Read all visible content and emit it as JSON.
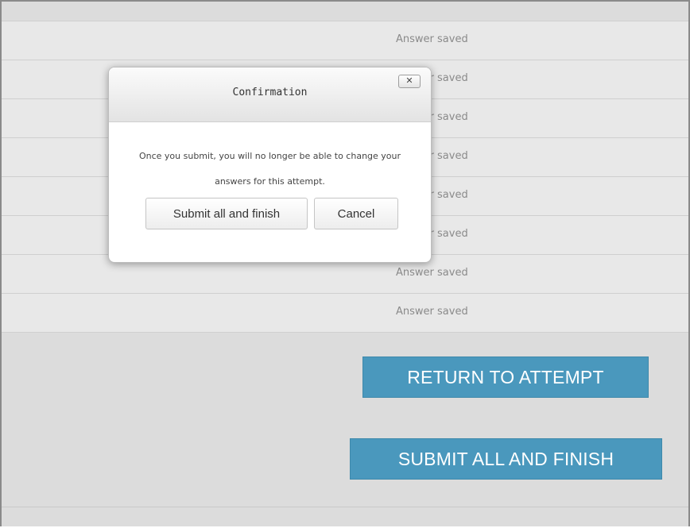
{
  "summary": {
    "rows": [
      {
        "status": "Answer saved"
      },
      {
        "status": "Answer saved"
      },
      {
        "status": "Answer saved"
      },
      {
        "status": "Answer saved"
      },
      {
        "status": "Answer saved"
      },
      {
        "status": "Answer saved"
      },
      {
        "status": "Answer saved"
      },
      {
        "status": "Answer saved"
      }
    ]
  },
  "actions": {
    "return_label": "RETURN TO ATTEMPT",
    "submit_label": "SUBMIT ALL AND FINISH"
  },
  "dialog": {
    "title": "Confirmation",
    "close_label": "✕",
    "message": "Once you submit, you will no longer be able to change your answers for this attempt.",
    "submit_label": "Submit all and finish",
    "cancel_label": "Cancel"
  },
  "colors": {
    "primary_button": "#4a98bd",
    "page_background": "#dcdcdc"
  }
}
